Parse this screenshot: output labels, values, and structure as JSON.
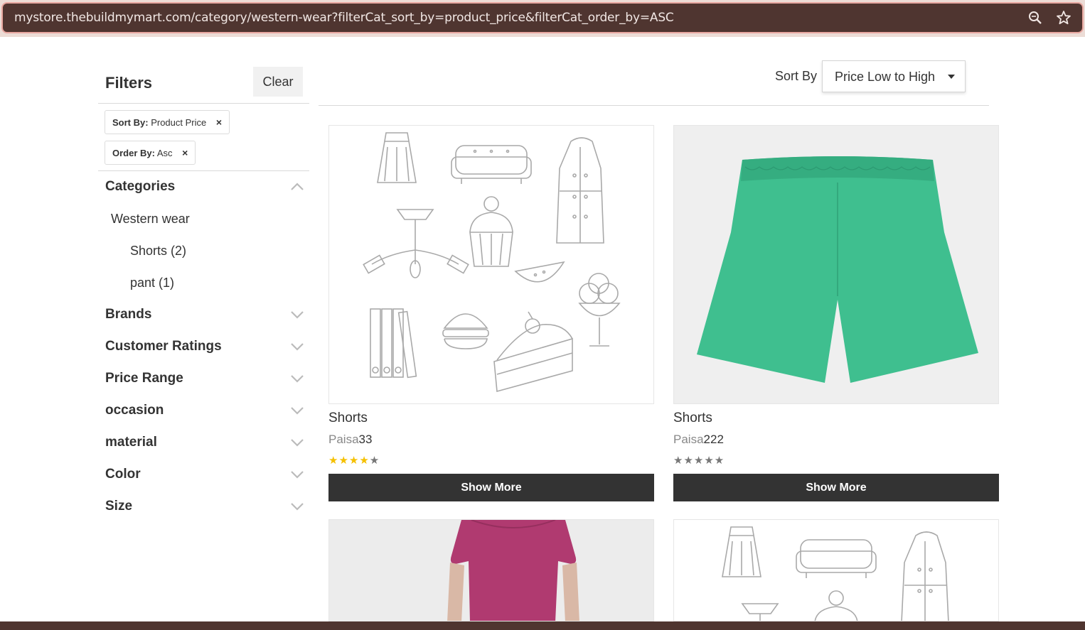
{
  "browser": {
    "url": "mystore.thebuildmymart.com/category/western-wear?filterCat_sort_by=product_price&filterCat_order_by=ASC"
  },
  "filters": {
    "title": "Filters",
    "clear_label": "Clear",
    "chips": [
      {
        "key": "Sort By:",
        "value": "Product Price",
        "remove": "×"
      },
      {
        "key": "Order By:",
        "value": "Asc",
        "remove": "×"
      }
    ],
    "categories_label": "Categories",
    "category_root": "Western wear",
    "subcategories": [
      {
        "label": "Shorts (2)"
      },
      {
        "label": "pant (1)"
      }
    ],
    "facets": [
      {
        "label": "Brands"
      },
      {
        "label": "Customer Ratings"
      },
      {
        "label": "Price Range"
      },
      {
        "label": "occasion"
      },
      {
        "label": "material"
      },
      {
        "label": "Color"
      },
      {
        "label": "Size"
      }
    ]
  },
  "sort": {
    "label": "Sort By",
    "value": "Price Low to High"
  },
  "products": [
    {
      "name": "Shorts",
      "currency": "Paisa",
      "price": "33",
      "rating": 4,
      "stars": "★★★★★",
      "button": "Show More",
      "image": "placeholder-line-icons"
    },
    {
      "name": "Shorts",
      "currency": "Paisa",
      "price": "222",
      "rating": 0,
      "stars": "★★★★★",
      "button": "Show More",
      "image": "green-shorts"
    },
    {
      "image": "pink-top"
    },
    {
      "image": "placeholder-line-icons"
    }
  ],
  "colors": {
    "button_bg": "#333333",
    "star_filled": "#f5c000",
    "star_empty": "#777777",
    "shorts_green": "#3fbf8f",
    "top_pink": "#b03a70",
    "url_bar": "#4f3530"
  }
}
